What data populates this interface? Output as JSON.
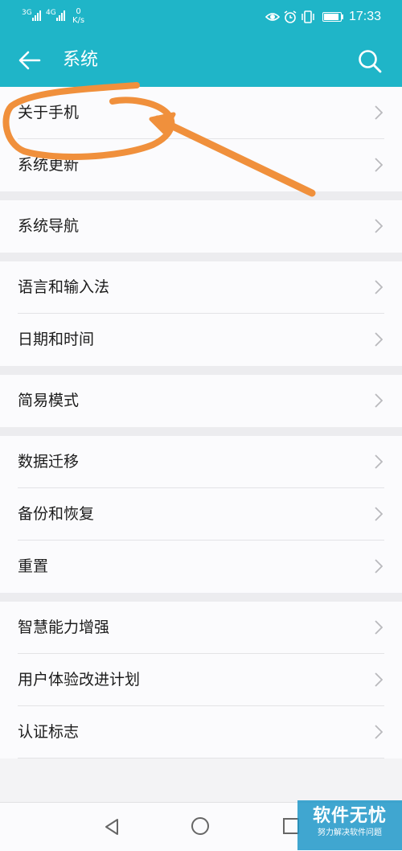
{
  "status_bar": {
    "sim1": "3G",
    "sim2": "4G",
    "speed_value": "0",
    "speed_unit": "K/s",
    "time": "17:33",
    "icons": [
      "eye-icon",
      "alarm-icon",
      "vibrate-icon",
      "battery-icon"
    ]
  },
  "toolbar": {
    "back_icon": "arrow-left-icon",
    "title": "系统",
    "search_icon": "search-icon"
  },
  "groups": [
    {
      "items": [
        {
          "label": "关于手机"
        },
        {
          "label": "系统更新"
        }
      ]
    },
    {
      "items": [
        {
          "label": "系统导航"
        }
      ]
    },
    {
      "items": [
        {
          "label": "语言和输入法"
        },
        {
          "label": "日期和时间"
        }
      ]
    },
    {
      "items": [
        {
          "label": "简易模式"
        }
      ]
    },
    {
      "items": [
        {
          "label": "数据迁移"
        },
        {
          "label": "备份和恢复"
        },
        {
          "label": "重置"
        }
      ]
    },
    {
      "items": [
        {
          "label": "智慧能力增强"
        },
        {
          "label": "用户体验改进计划"
        },
        {
          "label": "认证标志"
        }
      ]
    }
  ],
  "annotation": {
    "color": "#f0903c"
  },
  "nav_bar": {
    "icons": [
      "nav-back-icon",
      "nav-home-icon",
      "nav-recent-icon"
    ]
  },
  "watermark": {
    "main": "软件无忧",
    "sub": "努力解决软件问题"
  },
  "colors": {
    "header": "#1fb5c8",
    "background": "#f3f3f5",
    "chevron": "#b9b9bd"
  }
}
